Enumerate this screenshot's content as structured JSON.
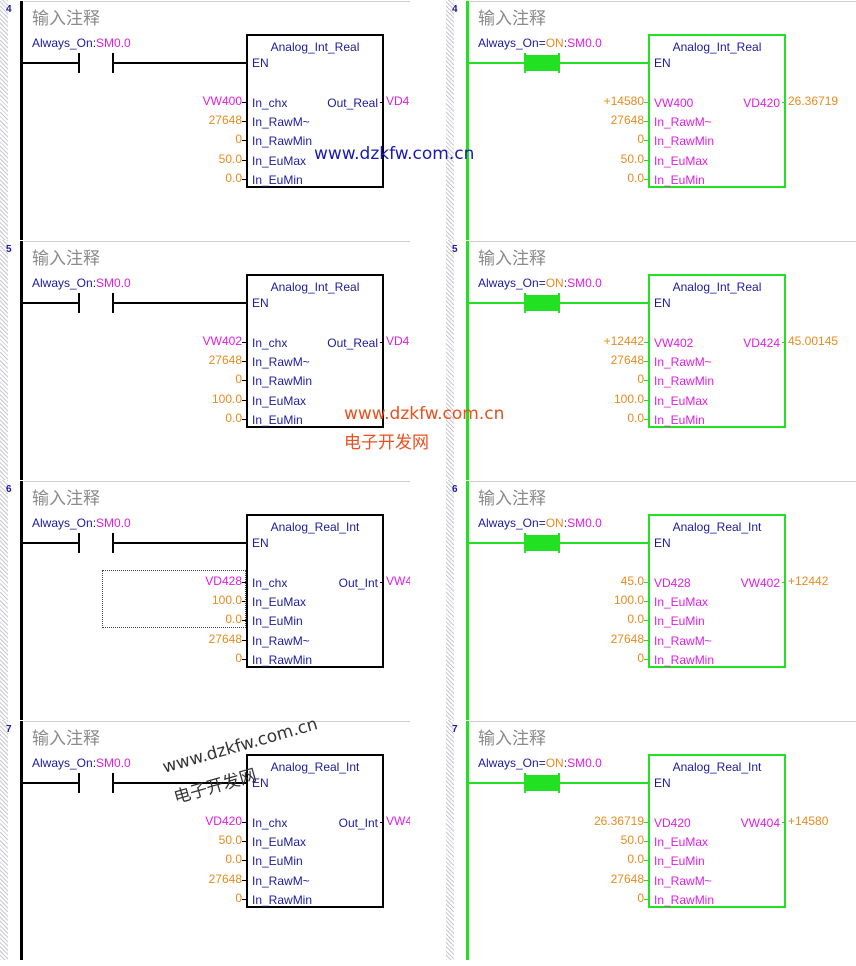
{
  "comment_text": "输入注释",
  "contact_label": "Always_On",
  "contact_sep": ":",
  "contact_addr": "SM0.0",
  "contact_eq": "=",
  "contact_state": "ON",
  "en_label": "EN",
  "watermark_url": "www.dzkfw.com.cn",
  "watermark_cn": "电子开发网",
  "rungs": {
    "r4": {
      "number": "4",
      "block": "Analog_Int_Real",
      "pins": [
        "In_chx",
        "In_RawM~",
        "In_RawMin",
        "In_EuMax",
        "In_EuMin"
      ],
      "out_pin": "Out_Real",
      "inputs": [
        "VW400",
        "27648",
        "0",
        "50.0",
        "0.0"
      ],
      "output": "VD420",
      "live_in_value": "+14580",
      "live_out_value": "26.36719"
    },
    "r5": {
      "number": "5",
      "block": "Analog_Int_Real",
      "pins": [
        "In_chx",
        "In_RawM~",
        "In_RawMin",
        "In_EuMax",
        "In_EuMin"
      ],
      "out_pin": "Out_Real",
      "inputs": [
        "VW402",
        "27648",
        "0",
        "100.0",
        "0.0"
      ],
      "output": "VD424",
      "live_in_value": "+12442",
      "live_out_value": "45.00145"
    },
    "r6": {
      "number": "6",
      "block": "Analog_Real_Int",
      "pins": [
        "In_chx",
        "In_EuMax",
        "In_EuMin",
        "In_RawM~",
        "In_RawMin"
      ],
      "out_pin": "Out_Int",
      "inputs": [
        "VD428",
        "100.0",
        "0.0",
        "27648",
        "0"
      ],
      "output": "VW402",
      "live_in_value": "45.0",
      "live_out_value": "+12442"
    },
    "r7": {
      "number": "7",
      "block": "Analog_Real_Int",
      "pins": [
        "In_chx",
        "In_EuMax",
        "In_EuMin",
        "In_RawM~",
        "In_RawMin"
      ],
      "out_pin": "Out_Int",
      "inputs": [
        "VD420",
        "50.0",
        "0.0",
        "27648",
        "0"
      ],
      "output": "VW404",
      "live_in_value": "26.36719",
      "live_out_value": "+14580"
    }
  },
  "colors": {
    "wire_on": "#22e022",
    "address": "#e01ee0",
    "value": "#e88a1e",
    "pin": "#1a1aa0",
    "comment": "#8a8a8a"
  }
}
